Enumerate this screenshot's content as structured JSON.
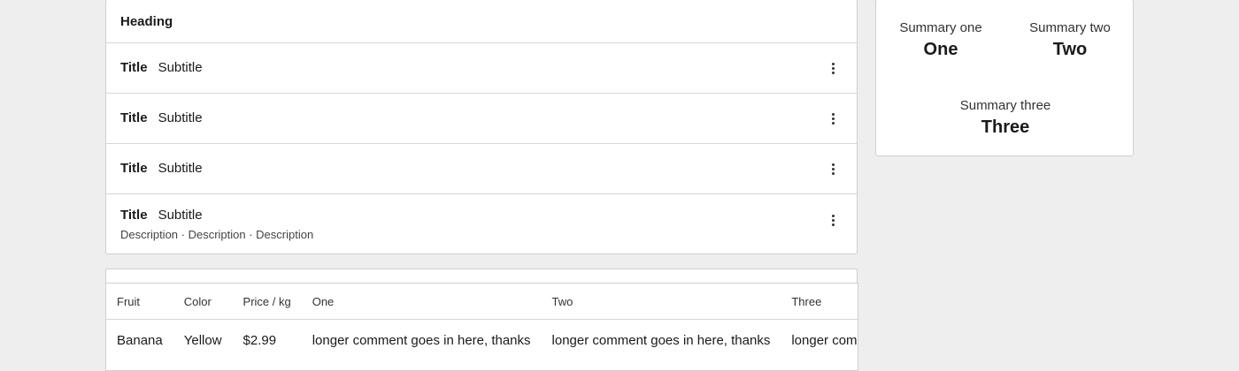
{
  "list": {
    "heading": "Heading",
    "rows": [
      {
        "title": "Title",
        "subtitle": "Subtitle"
      },
      {
        "title": "Title",
        "subtitle": "Subtitle"
      },
      {
        "title": "Title",
        "subtitle": "Subtitle"
      },
      {
        "title": "Title",
        "subtitle": "Subtitle",
        "description": "Description · Description · Description"
      }
    ],
    "menu_icon": "kebab-menu-icon"
  },
  "table": {
    "headers": [
      "Fruit",
      "Color",
      "Price / kg",
      "One",
      "Two",
      "Three"
    ],
    "rows": [
      [
        "Banana",
        "Yellow",
        "$2.99",
        "longer comment goes in here, thanks",
        "longer comment goes in here, thanks",
        "longer comment goes in here, thanks"
      ]
    ]
  },
  "summary": {
    "one": {
      "label": "Summary one",
      "value": "One"
    },
    "two": {
      "label": "Summary two",
      "value": "Two"
    },
    "three": {
      "label": "Summary three",
      "value": "Three"
    }
  }
}
